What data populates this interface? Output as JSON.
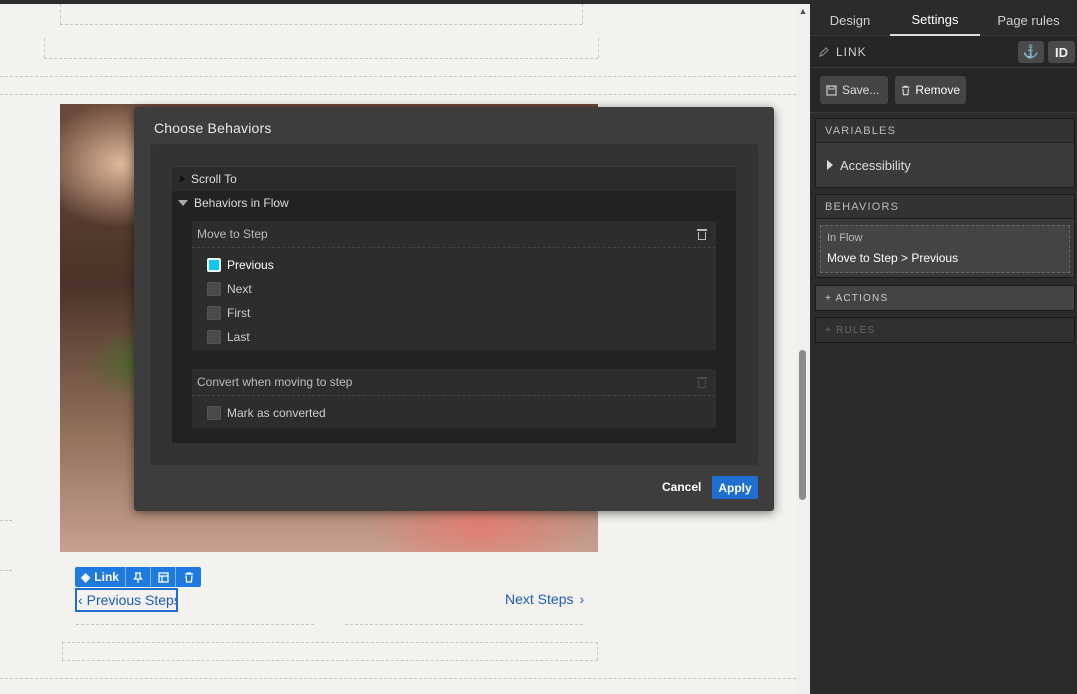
{
  "canvas": {
    "link_toolbar": {
      "label": "Link"
    },
    "prev_link": {
      "label": "Previous Steps",
      "chevron": "‹"
    },
    "next_link": {
      "label": "Next Steps",
      "chevron": "›"
    }
  },
  "modal": {
    "title": "Choose Behaviors",
    "rows": {
      "scroll_to": "Scroll To",
      "behaviors_in_flow": "Behaviors in Flow"
    },
    "move_to_step": {
      "title": "Move to Step",
      "options": [
        {
          "label": "Previous",
          "checked": true
        },
        {
          "label": "Next",
          "checked": false
        },
        {
          "label": "First",
          "checked": false
        },
        {
          "label": "Last",
          "checked": false
        }
      ]
    },
    "convert": {
      "title": "Convert when moving to step",
      "option": "Mark as converted"
    },
    "cancel_label": "Cancel",
    "apply_label": "Apply"
  },
  "panel": {
    "tabs": [
      "Design",
      "Settings",
      "Page rules"
    ],
    "active_tab": "Settings",
    "element_title": "LINK",
    "id_label": "ID",
    "save_label": "Save...",
    "remove_label": "Remove",
    "variables": {
      "title": "VARIABLES",
      "accessibility": "Accessibility"
    },
    "behaviors": {
      "title": "BEHAVIORS",
      "card_subtitle": "In Flow",
      "card_title": "Move to Step > Previous"
    },
    "actions": "+ ACTIONS",
    "rules": "+ RULES"
  },
  "colors": {
    "accent": "#1f6fd0",
    "checkbox_checked": "#11c6f0",
    "panel_bg": "#2b2b2b"
  }
}
